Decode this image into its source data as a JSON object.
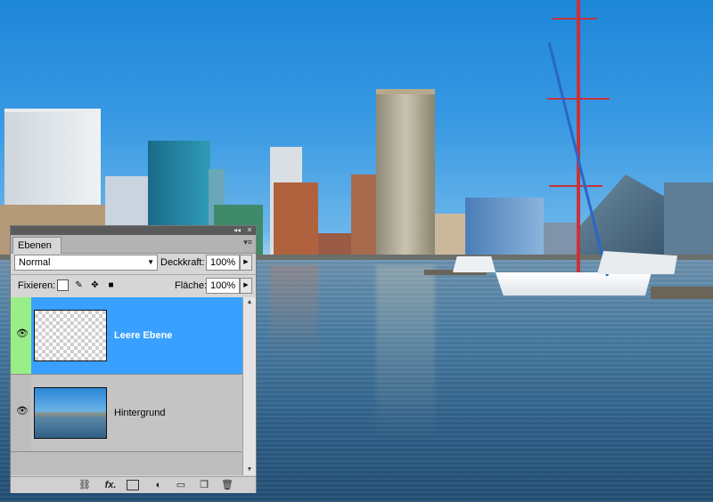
{
  "panel": {
    "tab_label": "Ebenen",
    "blend_mode": "Normal",
    "opacity_label": "Deckkraft:",
    "opacity_value": "100%",
    "lock_label": "Fixieren:",
    "fill_label": "Fläche:",
    "fill_value": "100%",
    "layers": [
      {
        "name": "Leere Ebene",
        "selected": true,
        "visible": true
      },
      {
        "name": "Hintergrund",
        "selected": false,
        "visible": true
      }
    ]
  },
  "colors": {
    "selected_layer": "#3aa0ff",
    "visibility_highlight": "#99ee88",
    "panel_bg": "#d6d6d6"
  },
  "icons": {
    "panel_collapse": "double-chevron-left-icon",
    "panel_close": "close-icon",
    "panel_menu": "panel-menu-icon",
    "locks": [
      "lock-transparent-icon",
      "lock-image-icon",
      "lock-position-icon",
      "lock-all-icon"
    ],
    "footer": [
      "link-layers-icon",
      "fx-icon",
      "add-mask-icon",
      "adjustment-layer-icon",
      "group-folder-icon",
      "new-layer-icon",
      "trash-icon"
    ]
  }
}
